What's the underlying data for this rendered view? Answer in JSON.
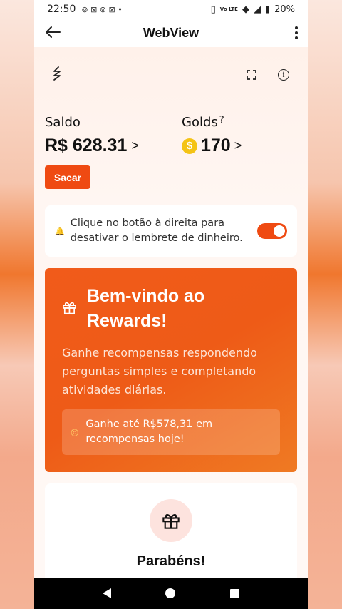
{
  "status_bar": {
    "time": "22:50",
    "network_label": "Vo LTE",
    "battery": "20%"
  },
  "app_bar": {
    "title": "WebView"
  },
  "balance": {
    "saldo_label": "Saldo",
    "saldo_value": "R$ 628.31",
    "golds_label": "Golds",
    "golds_help": "?",
    "golds_value": "170",
    "coin_symbol": "$",
    "chevron": ">",
    "withdraw_label": "Sacar"
  },
  "reminder": {
    "text": "Clique no botão à direita para desativar o lembrete de dinheiro.",
    "toggle_on": true
  },
  "welcome_card": {
    "title": "Bem-vindo ao Rewards!",
    "description": "Ganhe recompensas respondendo perguntas simples e completando atividades diárias.",
    "promo": "Ganhe até R$578,31 em recompensas hoje!"
  },
  "congrats_card": {
    "title": "Parabéns!"
  },
  "colors": {
    "accent": "#ef4a12",
    "coin": "#f4c315"
  }
}
